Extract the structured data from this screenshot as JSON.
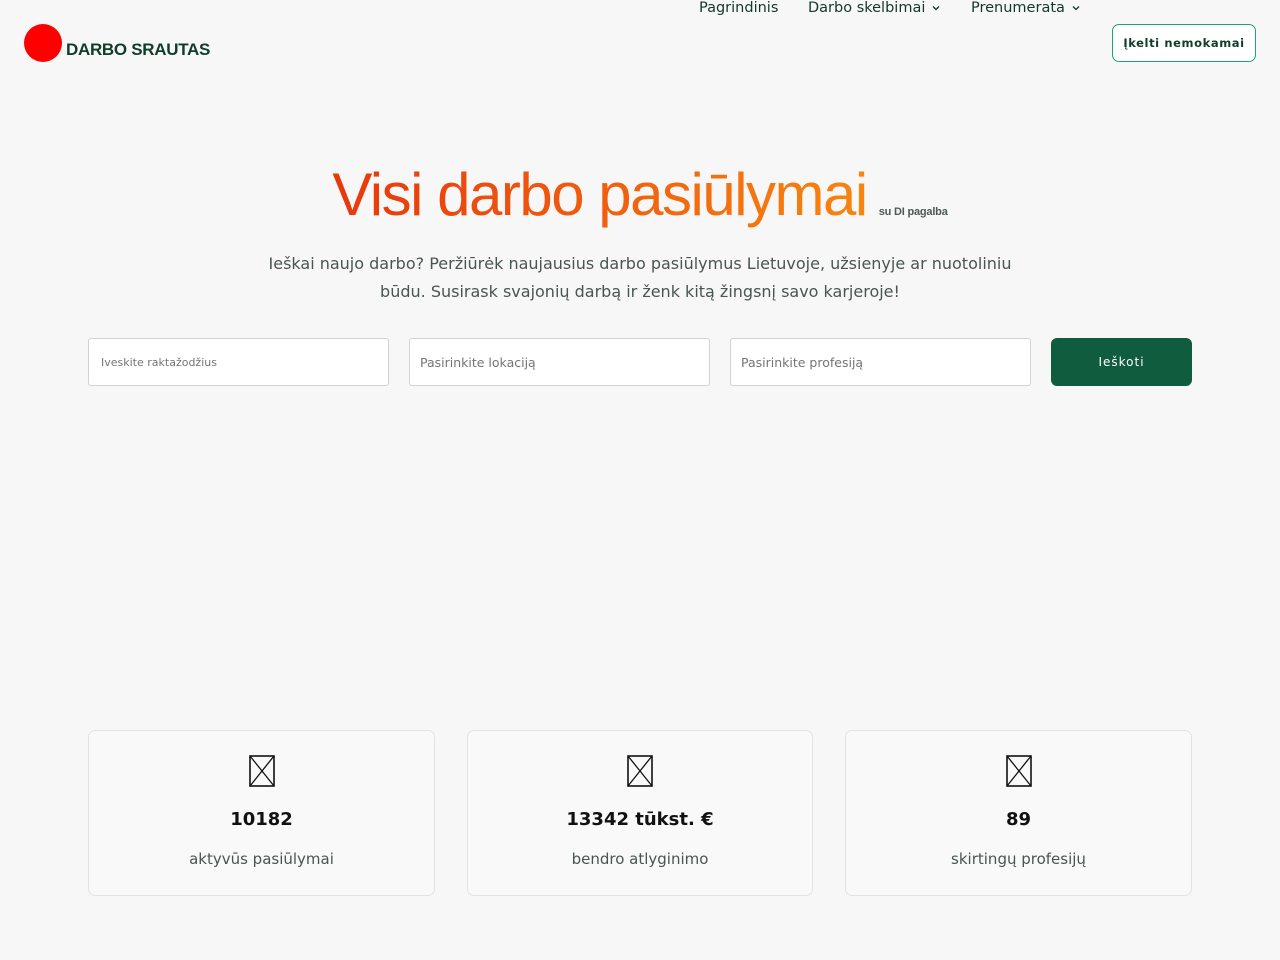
{
  "brand": {
    "name": "DARBO SRAUTAS",
    "logo_color": "#ff0000"
  },
  "nav": {
    "items": [
      {
        "label": "Pagrindinis",
        "has_dropdown": false
      },
      {
        "label": "Darbo skelbimai",
        "has_dropdown": true
      },
      {
        "label": "Prenumerata",
        "has_dropdown": true
      }
    ],
    "cta_label": "Įkelti nemokamai"
  },
  "hero": {
    "title": "Visi darbo pasiūlymai",
    "title_suffix": "su DI pagalba",
    "description": "Ieškai naujo darbo? Peržiūrėk naujausius darbo pasiūlymus Lietuvoje, užsienyje ar nuotoliniu būdu. Susirask svajonių darbą ir ženk kitą žingsnį savo karjeroje!"
  },
  "search": {
    "keywords_placeholder": "Iveskite raktažodžius",
    "location_placeholder": "Pasirinkite lokaciją",
    "profession_placeholder": "Pasirinkite profesiją",
    "button_label": "Ieškoti"
  },
  "stats": [
    {
      "icon": "broken-image-icon",
      "value": "10182",
      "label": "aktyvūs pasiūlymai"
    },
    {
      "icon": "broken-image-icon",
      "value": "13342 tūkst. €",
      "label": "bendro atlyginimo"
    },
    {
      "icon": "broken-image-icon",
      "value": "89",
      "label": "skirtingų profesijų"
    }
  ],
  "colors": {
    "accent_green": "#0f5c3f",
    "cta_border": "#1aa37a",
    "title_gradient_start": "#e6380c",
    "title_gradient_end": "#f7860f"
  }
}
